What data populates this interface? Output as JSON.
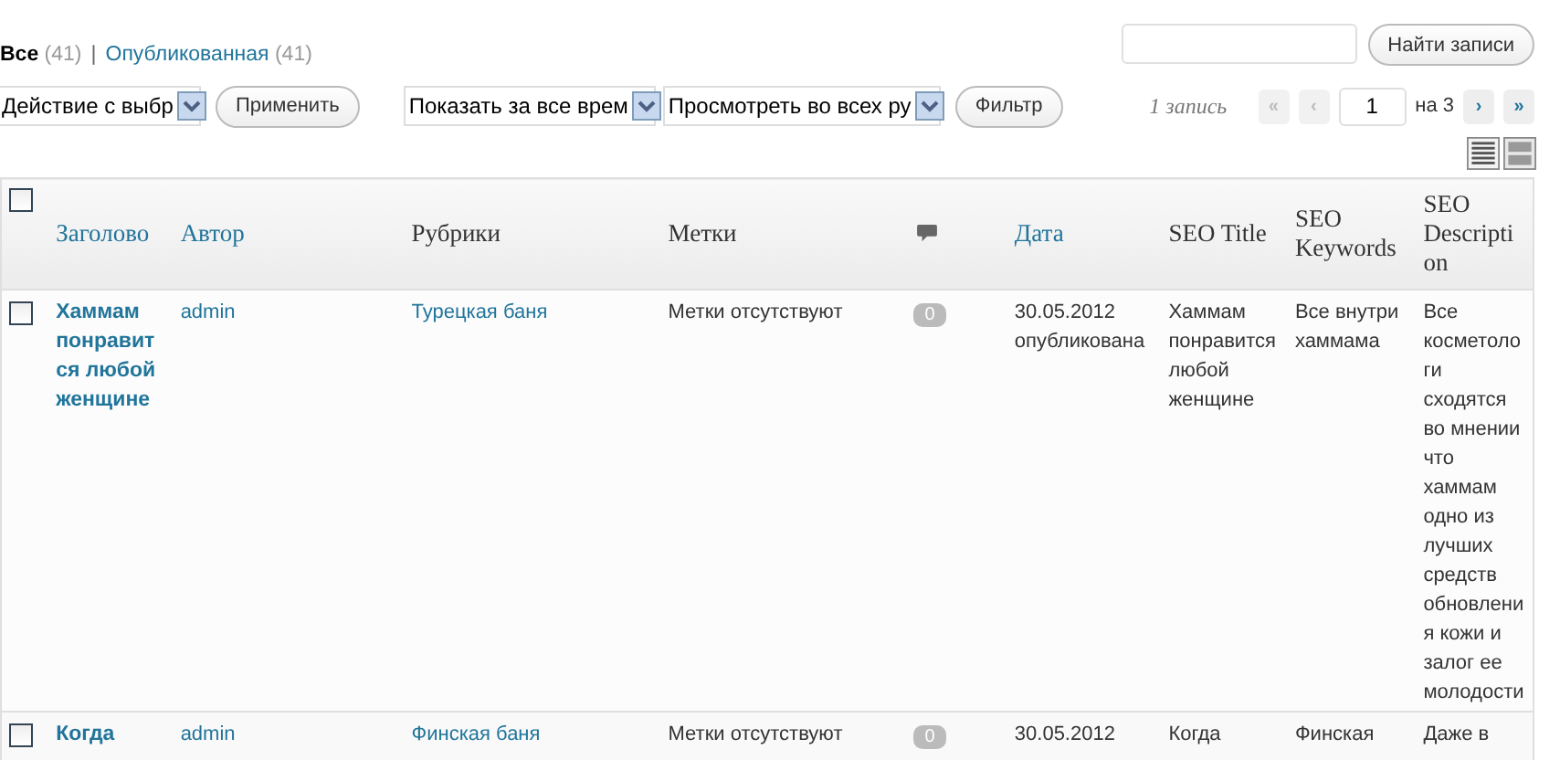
{
  "status_links": [
    {
      "label": "Все",
      "count": "(41)",
      "selected": true
    },
    {
      "label": "Опубликованная",
      "count": "(41)",
      "selected": false
    }
  ],
  "status_separator": "|",
  "search": {
    "button": "Найти записи"
  },
  "bulk_action": {
    "value": "Действие с выбр",
    "button": "Применить"
  },
  "filters": [
    {
      "value": "Показать за все врем"
    },
    {
      "value": "Просмотреть во всех ру"
    }
  ],
  "filter_button": "Фильтр",
  "pagination": {
    "count": "1 запись",
    "prev": [
      {
        "label": "«",
        "disabled": true
      },
      {
        "label": "‹",
        "disabled": true
      }
    ],
    "page": "1",
    "of": "на 3",
    "next": [
      {
        "label": "›",
        "disabled": false
      },
      {
        "label": "»",
        "disabled": false
      }
    ]
  },
  "view_modes": [
    {
      "kind": "list",
      "selected": true
    },
    {
      "kind": "excerpt",
      "selected": false
    }
  ],
  "table": {
    "columns": [
      {
        "kind": "checkbox",
        "checked": false
      },
      {
        "kind": "text",
        "label": "Заголово",
        "link": true
      },
      {
        "kind": "text",
        "label": "Автор",
        "link": true
      },
      {
        "kind": "text",
        "label": "Рубрики",
        "link": false
      },
      {
        "kind": "text",
        "label": "Метки",
        "link": false
      },
      {
        "kind": "comments"
      },
      {
        "kind": "text",
        "label": "Дата",
        "link": true
      },
      {
        "kind": "text",
        "label": "SEO Title",
        "link": false
      },
      {
        "kind": "text",
        "label": "SEO Keywords",
        "link": false
      },
      {
        "kind": "text",
        "label": "SEO Description",
        "link": false
      }
    ],
    "rows": [
      {
        "checked": false,
        "title": "Хаммам понравится любой женщине",
        "author": "admin",
        "category": "Турецкая баня",
        "tags": "Метки отсутствуют",
        "comments": "0",
        "date": "30.05.2012",
        "status": "опубликована",
        "seo_title": "Хаммам понравится любой женщине",
        "seo_keywords": "Все внутри хаммама",
        "seo_description": "Все косметологи сходятся во мнении что хаммам одно из лучших средств обновления кожи и залог ее молодости"
      },
      {
        "checked": false,
        "title": "Когда",
        "author": "admin",
        "category": "Финская баня",
        "tags": "Метки отсутствуют",
        "comments": "0",
        "date": "30.05.2012",
        "seo_title": "Когда",
        "seo_keywords": "Финская",
        "seo_description": "Даже в"
      }
    ]
  }
}
